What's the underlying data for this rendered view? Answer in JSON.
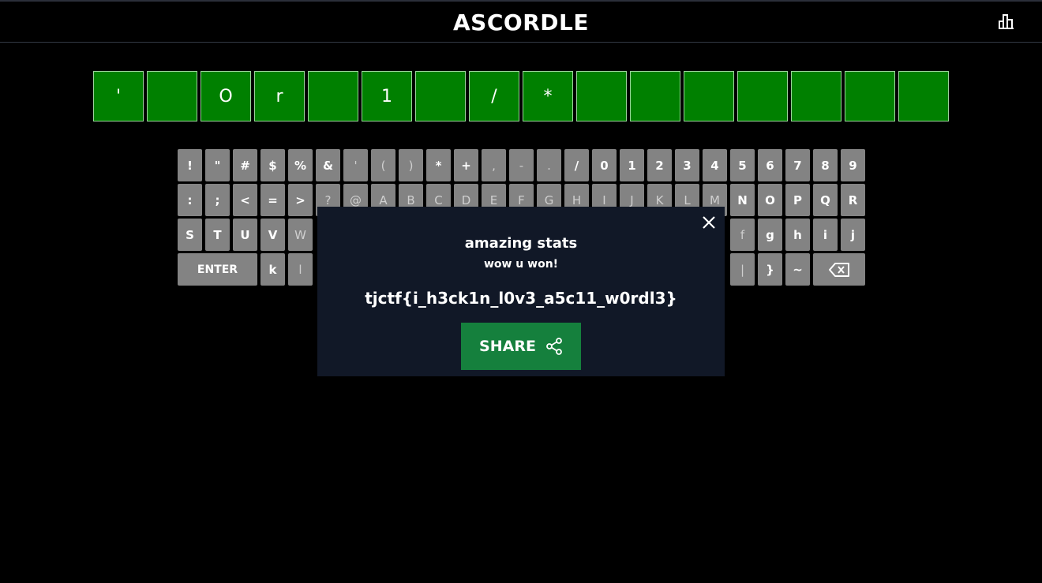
{
  "app": {
    "title": "ASCORDLE"
  },
  "header": {
    "stats_icon": "bar-chart-icon"
  },
  "board": {
    "tiles": [
      "'",
      "",
      "O",
      "r",
      "",
      "1",
      "",
      "/",
      "*",
      "",
      "",
      "",
      "",
      "",
      "",
      ""
    ]
  },
  "keyboard": {
    "row1": [
      "!",
      "\"",
      "#",
      "$",
      "%",
      "&",
      "'",
      "(",
      ")",
      "*",
      "+",
      ",",
      "-",
      ".",
      "/",
      "0",
      "1",
      "2",
      "3",
      "4",
      "5",
      "6",
      "7",
      "8",
      "9"
    ],
    "row2": [
      ":",
      ";",
      "<",
      "=",
      ">",
      "?",
      "@",
      "A",
      "B",
      "C",
      "D",
      "E",
      "F",
      "G",
      "H",
      "I",
      "J",
      "K",
      "L",
      "M",
      "N",
      "O",
      "P",
      "Q",
      "R"
    ],
    "row3_left": [
      "S",
      "T",
      "U",
      "V",
      "W"
    ],
    "row3_right": [
      "f",
      "g",
      "h",
      "i",
      "j"
    ],
    "row4_left": [
      "k",
      "l"
    ],
    "row4_right": [
      "|",
      "}",
      "~"
    ],
    "enter_label": "ENTER",
    "backspace_icon": "backspace-icon"
  },
  "modal": {
    "title": "amazing stats",
    "subtitle": "wow u won!",
    "flag": "tjctf{i_h3ck1n_l0v3_a5c11_w0rdl3}",
    "share_label": "SHARE",
    "share_icon": "share-icon",
    "close_icon": "close-icon"
  },
  "colors": {
    "correct": "#008000",
    "key": "#838383",
    "modal_bg": "#111827",
    "share_btn": "#15803d"
  }
}
